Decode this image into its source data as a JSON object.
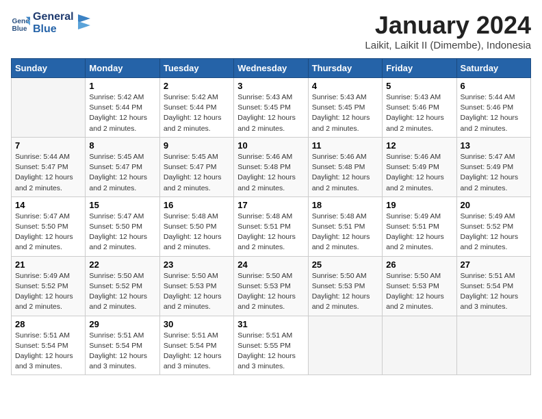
{
  "logo": {
    "line1": "General",
    "line2": "Blue"
  },
  "title": "January 2024",
  "subtitle": "Laikit, Laikit II (Dimembe), Indonesia",
  "days_of_week": [
    "Sunday",
    "Monday",
    "Tuesday",
    "Wednesday",
    "Thursday",
    "Friday",
    "Saturday"
  ],
  "weeks": [
    [
      {
        "num": "",
        "info": ""
      },
      {
        "num": "1",
        "info": "Sunrise: 5:42 AM\nSunset: 5:44 PM\nDaylight: 12 hours\nand 2 minutes."
      },
      {
        "num": "2",
        "info": "Sunrise: 5:42 AM\nSunset: 5:44 PM\nDaylight: 12 hours\nand 2 minutes."
      },
      {
        "num": "3",
        "info": "Sunrise: 5:43 AM\nSunset: 5:45 PM\nDaylight: 12 hours\nand 2 minutes."
      },
      {
        "num": "4",
        "info": "Sunrise: 5:43 AM\nSunset: 5:45 PM\nDaylight: 12 hours\nand 2 minutes."
      },
      {
        "num": "5",
        "info": "Sunrise: 5:43 AM\nSunset: 5:46 PM\nDaylight: 12 hours\nand 2 minutes."
      },
      {
        "num": "6",
        "info": "Sunrise: 5:44 AM\nSunset: 5:46 PM\nDaylight: 12 hours\nand 2 minutes."
      }
    ],
    [
      {
        "num": "7",
        "info": "Sunrise: 5:44 AM\nSunset: 5:47 PM\nDaylight: 12 hours\nand 2 minutes."
      },
      {
        "num": "8",
        "info": "Sunrise: 5:45 AM\nSunset: 5:47 PM\nDaylight: 12 hours\nand 2 minutes."
      },
      {
        "num": "9",
        "info": "Sunrise: 5:45 AM\nSunset: 5:47 PM\nDaylight: 12 hours\nand 2 minutes."
      },
      {
        "num": "10",
        "info": "Sunrise: 5:46 AM\nSunset: 5:48 PM\nDaylight: 12 hours\nand 2 minutes."
      },
      {
        "num": "11",
        "info": "Sunrise: 5:46 AM\nSunset: 5:48 PM\nDaylight: 12 hours\nand 2 minutes."
      },
      {
        "num": "12",
        "info": "Sunrise: 5:46 AM\nSunset: 5:49 PM\nDaylight: 12 hours\nand 2 minutes."
      },
      {
        "num": "13",
        "info": "Sunrise: 5:47 AM\nSunset: 5:49 PM\nDaylight: 12 hours\nand 2 minutes."
      }
    ],
    [
      {
        "num": "14",
        "info": "Sunrise: 5:47 AM\nSunset: 5:50 PM\nDaylight: 12 hours\nand 2 minutes."
      },
      {
        "num": "15",
        "info": "Sunrise: 5:47 AM\nSunset: 5:50 PM\nDaylight: 12 hours\nand 2 minutes."
      },
      {
        "num": "16",
        "info": "Sunrise: 5:48 AM\nSunset: 5:50 PM\nDaylight: 12 hours\nand 2 minutes."
      },
      {
        "num": "17",
        "info": "Sunrise: 5:48 AM\nSunset: 5:51 PM\nDaylight: 12 hours\nand 2 minutes."
      },
      {
        "num": "18",
        "info": "Sunrise: 5:48 AM\nSunset: 5:51 PM\nDaylight: 12 hours\nand 2 minutes."
      },
      {
        "num": "19",
        "info": "Sunrise: 5:49 AM\nSunset: 5:51 PM\nDaylight: 12 hours\nand 2 minutes."
      },
      {
        "num": "20",
        "info": "Sunrise: 5:49 AM\nSunset: 5:52 PM\nDaylight: 12 hours\nand 2 minutes."
      }
    ],
    [
      {
        "num": "21",
        "info": "Sunrise: 5:49 AM\nSunset: 5:52 PM\nDaylight: 12 hours\nand 2 minutes."
      },
      {
        "num": "22",
        "info": "Sunrise: 5:50 AM\nSunset: 5:52 PM\nDaylight: 12 hours\nand 2 minutes."
      },
      {
        "num": "23",
        "info": "Sunrise: 5:50 AM\nSunset: 5:53 PM\nDaylight: 12 hours\nand 2 minutes."
      },
      {
        "num": "24",
        "info": "Sunrise: 5:50 AM\nSunset: 5:53 PM\nDaylight: 12 hours\nand 2 minutes."
      },
      {
        "num": "25",
        "info": "Sunrise: 5:50 AM\nSunset: 5:53 PM\nDaylight: 12 hours\nand 2 minutes."
      },
      {
        "num": "26",
        "info": "Sunrise: 5:50 AM\nSunset: 5:53 PM\nDaylight: 12 hours\nand 2 minutes."
      },
      {
        "num": "27",
        "info": "Sunrise: 5:51 AM\nSunset: 5:54 PM\nDaylight: 12 hours\nand 3 minutes."
      }
    ],
    [
      {
        "num": "28",
        "info": "Sunrise: 5:51 AM\nSunset: 5:54 PM\nDaylight: 12 hours\nand 3 minutes."
      },
      {
        "num": "29",
        "info": "Sunrise: 5:51 AM\nSunset: 5:54 PM\nDaylight: 12 hours\nand 3 minutes."
      },
      {
        "num": "30",
        "info": "Sunrise: 5:51 AM\nSunset: 5:54 PM\nDaylight: 12 hours\nand 3 minutes."
      },
      {
        "num": "31",
        "info": "Sunrise: 5:51 AM\nSunset: 5:55 PM\nDaylight: 12 hours\nand 3 minutes."
      },
      {
        "num": "",
        "info": ""
      },
      {
        "num": "",
        "info": ""
      },
      {
        "num": "",
        "info": ""
      }
    ]
  ]
}
